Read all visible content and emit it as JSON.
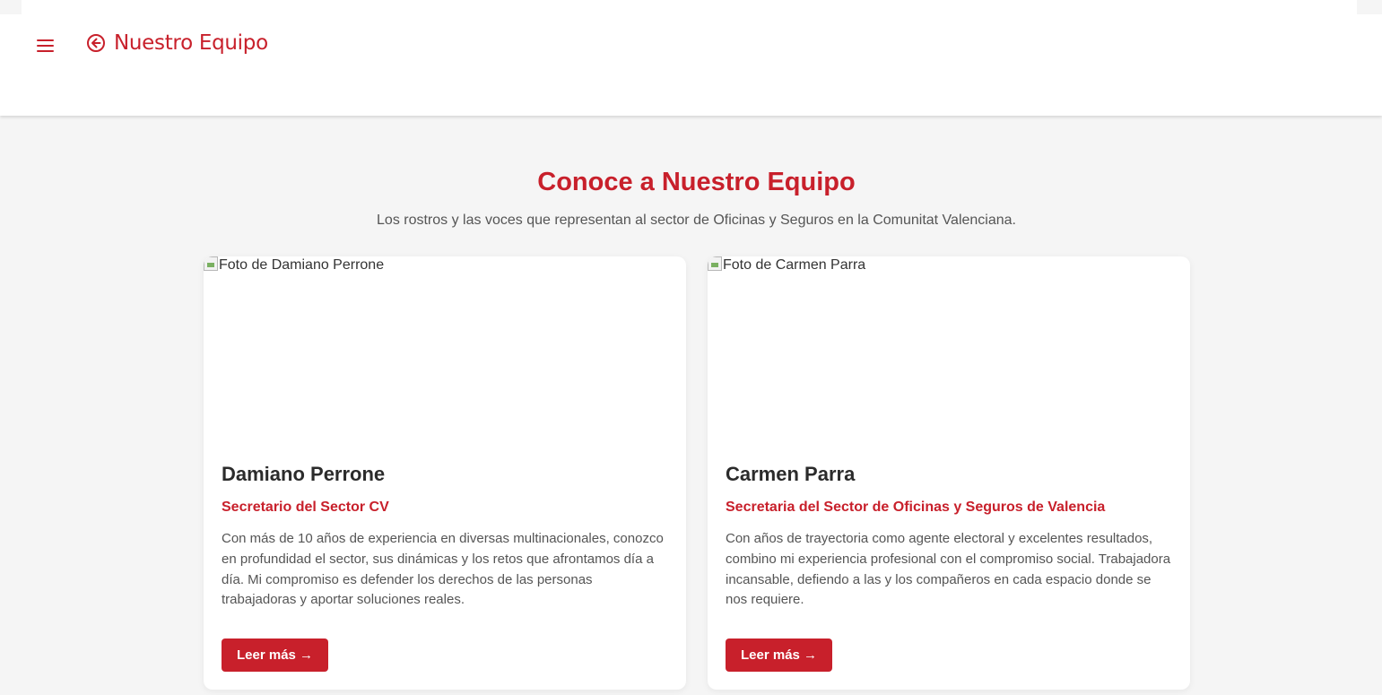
{
  "header": {
    "menu_icon": "hamburger-menu-icon",
    "back_icon": "circle-arrow-left-icon",
    "title": "Nuestro Equipo",
    "accent_color": "#c8202b"
  },
  "section": {
    "title": "Conoce a Nuestro Equipo",
    "subtitle": "Los rostros y las voces que representan al sector de Oficinas y Seguros en la Comunitat Valenciana."
  },
  "members": [
    {
      "photo_alt": "Foto de Damiano Perrone",
      "name": "Damiano Perrone",
      "role": "Secretario del Sector CV",
      "bio": "Con más de 10 años de experiencia en diversas multinacionales, conozco en profundidad el sector, sus dinámicas y los retos que afrontamos día a día. Mi compromiso es defender los derechos de las personas trabajadoras y aportar soluciones reales.",
      "button_label": "Leer más →"
    },
    {
      "photo_alt": "Foto de Carmen Parra",
      "name": "Carmen Parra",
      "role": "Secretaria del Sector de Oficinas y Seguros de Valencia",
      "bio": "Con años de trayectoria como agente electoral y excelentes resultados, combino mi experiencia profesional con el compromiso social. Trabajadora incansable, defiendo a las y los compañeros en cada espacio donde se nos requiere.",
      "button_label": "Leer más →"
    }
  ]
}
